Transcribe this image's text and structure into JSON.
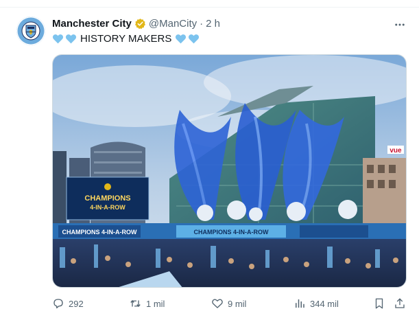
{
  "tweet": {
    "author_name": "Manchester City",
    "author_handle": "@ManCity",
    "separator": "·",
    "time": "2 h",
    "text": "HISTORY MAKERS",
    "verified_color": "#e2b719",
    "heart_color": "#6cabdd"
  },
  "media": {
    "screen_title": "CHAMPIONS",
    "screen_subtitle": "4-IN-A-ROW",
    "banner_left": "CHAMPIONS 4-IN-A-ROW",
    "banner_center": "CHAMPIONS 4-IN-A-ROW",
    "store_sign": "vue"
  },
  "actions": {
    "replies": "292",
    "retweets": "1 mil",
    "likes": "9 mil",
    "views": "344 mil"
  },
  "icons": {
    "reply": "reply-icon",
    "retweet": "retweet-icon",
    "like": "like-icon",
    "views": "views-icon",
    "bookmark": "bookmark-icon",
    "share": "share-icon",
    "more": "more-icon",
    "verified": "verified-badge-icon"
  }
}
